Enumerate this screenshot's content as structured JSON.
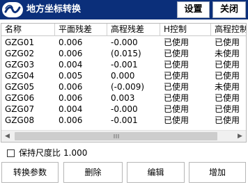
{
  "titlebar": {
    "title": "地方坐标转换",
    "settings_label": "设置",
    "close_label": "关闭",
    "logo_icon": "app-logo-icon"
  },
  "table": {
    "columns": [
      "名称",
      "平面残差",
      "高程残差",
      "H控制",
      "高程控制"
    ],
    "rows": [
      [
        "GZG01",
        "0.006",
        "-0.000",
        "已使用",
        "已使用"
      ],
      [
        "GZG02",
        "0.006",
        "(0.015)",
        "已使用",
        "未使用"
      ],
      [
        "GZG03",
        "0.004",
        "-0.001",
        "已使用",
        "已使用"
      ],
      [
        "GZG04",
        "0.005",
        "0.000",
        "已使用",
        "已使用"
      ],
      [
        "GZG05",
        "0.006",
        "(-0.009)",
        "已使用",
        "未使用"
      ],
      [
        "GZG06",
        "0.006",
        "0.003",
        "已使用",
        "已使用"
      ],
      [
        "GZG07",
        "0.004",
        "-0.000",
        "已使用",
        "已使用"
      ],
      [
        "GZG08",
        "0.006",
        "-0.001",
        "已使用",
        "已使用"
      ]
    ]
  },
  "options": {
    "keep_scale_label": "保持尺度比",
    "scale_value": "1.000",
    "keep_scale_checked": false
  },
  "buttons": {
    "convert_params": "转换参数",
    "delete": "删除",
    "edit": "编辑",
    "add": "增加"
  },
  "colors": {
    "titlebar_bg": "#0b2f7a",
    "titlebar_text": "#ffffff"
  }
}
